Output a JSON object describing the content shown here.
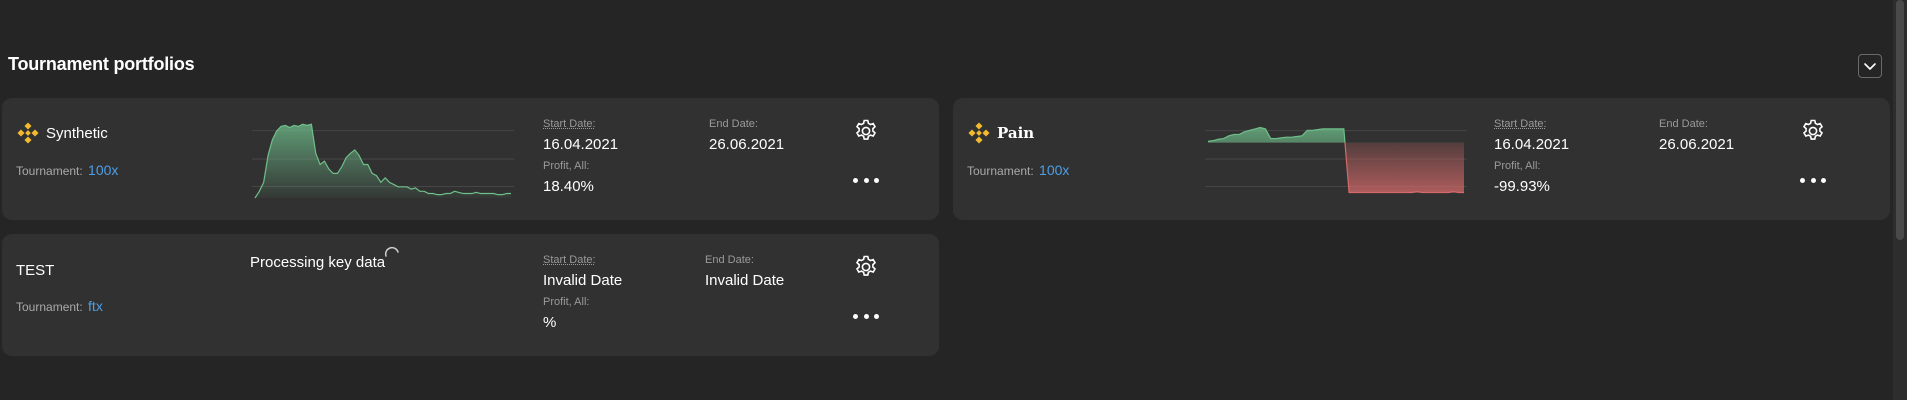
{
  "section": {
    "title": "Tournament portfolios"
  },
  "colors": {
    "background": "#252525",
    "card": "#313131",
    "link": "#4d9fe6",
    "gain": "#6fbf8b",
    "loss": "#d66a6a",
    "binance": "#f3ba2f"
  },
  "cards": [
    {
      "name": "Synthetic",
      "icon": "binance-logo-icon",
      "tournament_label": "Tournament:",
      "tournament_value": "100x",
      "start_label": "Start Date:",
      "start_value": "16.04.2021",
      "end_label": "End Date:",
      "end_value": "26.06.2021",
      "profit_label": "Profit, All:",
      "profit_value": "18.40%",
      "chart_series": [
        0,
        6,
        14,
        38,
        52,
        60,
        64,
        65,
        63,
        65,
        64,
        66,
        65,
        66,
        40,
        30,
        33,
        26,
        22,
        22,
        28,
        36,
        40,
        43,
        38,
        30,
        30,
        22,
        20,
        14,
        18,
        14,
        12,
        10,
        10,
        10,
        8,
        9,
        6,
        6,
        4,
        4,
        3,
        3,
        4,
        4,
        6,
        5,
        4,
        4,
        4,
        5,
        4,
        4,
        4,
        4,
        3,
        3,
        4,
        4
      ]
    },
    {
      "name": "Pain",
      "icon": "binance-logo-icon",
      "tournament_label": "Tournament:",
      "tournament_value": "100x",
      "start_label": "Start Date:",
      "start_value": "16.04.2021",
      "end_label": "End Date:",
      "end_value": "26.06.2021",
      "profit_label": "Profit, All:",
      "profit_value": "-99.93%",
      "chart_series": [
        2,
        3,
        5,
        6,
        10,
        12,
        12,
        16,
        18,
        20,
        22,
        20,
        6,
        6,
        7,
        8,
        8,
        9,
        10,
        18,
        18,
        19,
        20,
        20,
        20,
        20,
        20,
        -72,
        -72,
        -72,
        -72,
        -72,
        -72,
        -72,
        -72,
        -72,
        -72,
        -72,
        -72,
        -72,
        -71,
        -72,
        -72,
        -72,
        -72,
        -72,
        -72,
        -71,
        -72,
        -72
      ]
    },
    {
      "name": "TEST",
      "tournament_label": "Tournament:",
      "tournament_value": "ftx",
      "processing_text": "Processing key data",
      "start_label": "Start Date:",
      "start_value": "Invalid Date",
      "end_label": "End Date:",
      "end_value": "Invalid Date",
      "profit_label": "Profit, All:",
      "profit_value": "%"
    }
  ]
}
